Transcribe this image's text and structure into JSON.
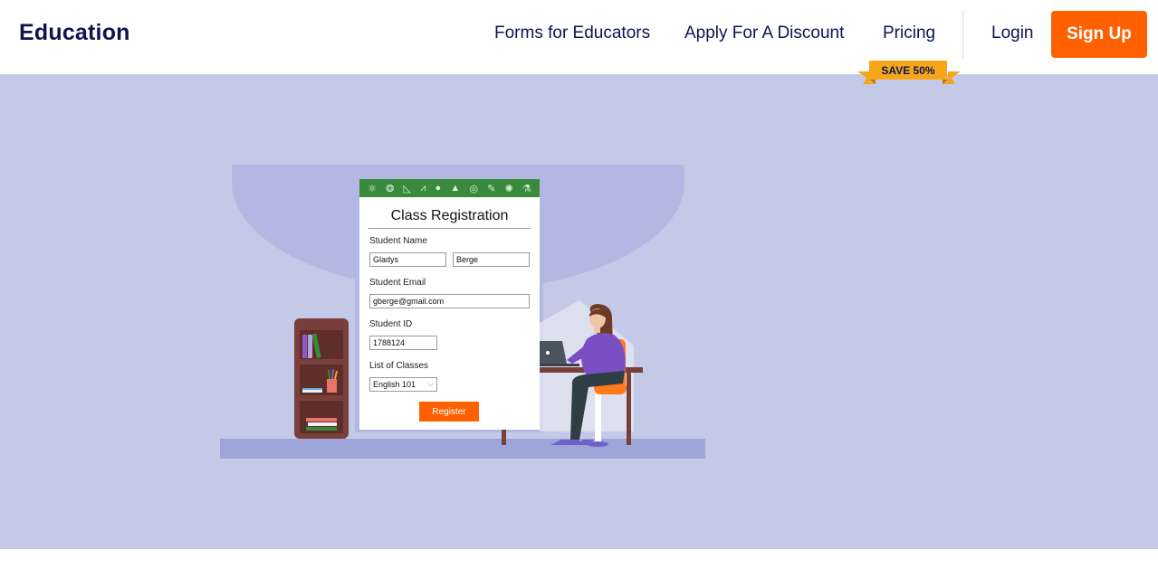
{
  "header": {
    "brand": "Education",
    "nav": {
      "forms": "Forms for Educators",
      "discount": "Apply For A Discount",
      "pricing": "Pricing",
      "login": "Login",
      "signup": "Sign Up"
    },
    "ribbon": "SAVE 50%"
  },
  "form": {
    "title": "Class Registration",
    "student_name_label": "Student Name",
    "first_name": "Gladys",
    "last_name": "Berge",
    "email_label": "Student Email",
    "email": "gberge@gmail.com",
    "id_label": "Student ID",
    "student_id": "1788124",
    "classes_label": "List of Classes",
    "selected_class": "English 101",
    "register": "Register"
  },
  "colors": {
    "brand_navy": "#0a1551",
    "accent_orange": "#ff6100",
    "hero_bg": "#c5c9e8",
    "ribbon": "#f7a61a"
  },
  "icons": [
    "atom-icon",
    "palette-icon",
    "ruler-icon",
    "compass-icon",
    "apple-icon",
    "grad-cap-icon",
    "globe-icon",
    "pencil-icon",
    "lightbulb-icon",
    "flask-icon"
  ]
}
